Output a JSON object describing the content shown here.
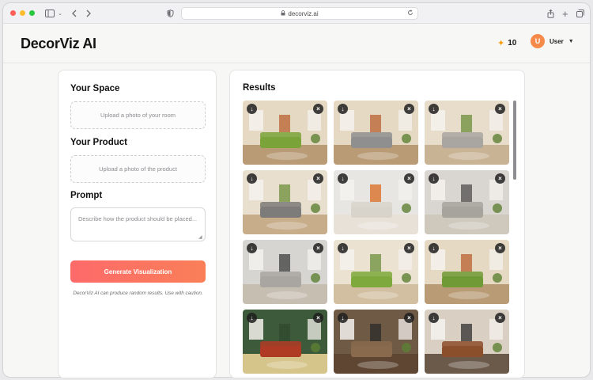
{
  "browser": {
    "url": "decorviz.ai"
  },
  "header": {
    "brand": "DecorViz AI",
    "credits": "10",
    "user": {
      "initial": "U",
      "name": "User"
    }
  },
  "form": {
    "space_title": "Your Space",
    "space_upload": "Upload a photo of your room",
    "product_title": "Your Product",
    "product_upload": "Upload a photo of the product",
    "prompt_title": "Prompt",
    "prompt_placeholder": "Describe how the product should be placed...",
    "prompt_value": "",
    "generate_label": "Generate Visualization",
    "disclaimer": "DecorViz AI can produce random results. Use with caution."
  },
  "results": {
    "title": "Results",
    "tiles": [
      {
        "name": "fireplace-room-green-sofa",
        "wall": "#e6d9c4",
        "floor": "#b99b76",
        "sofa": "#7aa33a",
        "accent": "#b8612f"
      },
      {
        "name": "fireplace-room-gray-sofa",
        "wall": "#e6d9c4",
        "floor": "#b99b76",
        "sofa": "#8f8f8f",
        "accent": "#b8612f"
      },
      {
        "name": "beige-room-gray-sectional",
        "wall": "#e8dccb",
        "floor": "#c9b395",
        "sofa": "#a9a6a2",
        "accent": "#6b8f3a"
      },
      {
        "name": "beige-room-tufted-sofa",
        "wall": "#e9dfcf",
        "floor": "#c7ad8a",
        "sofa": "#7e7c7a",
        "accent": "#6b8f3a"
      },
      {
        "name": "white-room-fireplace-art",
        "wall": "#e8e6e2",
        "floor": "#e7e1d8",
        "sofa": "#d8d3cb",
        "accent": "#d9681e"
      },
      {
        "name": "gray-room-sectional",
        "wall": "#d9d6d1",
        "floor": "#cfc8bd",
        "sofa": "#a7a39d",
        "accent": "#4e4e4e"
      },
      {
        "name": "gray-room-window-sofa",
        "wall": "#d7d5d1",
        "floor": "#c6beb1",
        "sofa": "#a9a5a0",
        "accent": "#3d3d3d"
      },
      {
        "name": "beige-room-green-sofa",
        "wall": "#ece2d2",
        "floor": "#d2bea0",
        "sofa": "#7ea93c",
        "accent": "#6b8f3a"
      },
      {
        "name": "fireplace-room-green-sofa-2",
        "wall": "#e6d9c4",
        "floor": "#b99b76",
        "sofa": "#6f9a36",
        "accent": "#b8612f"
      },
      {
        "name": "green-room-patterned-rug",
        "wall": "#3d5a3a",
        "floor": "#d6c58a",
        "sofa": "#b03b25",
        "accent": "#2f4a2d"
      },
      {
        "name": "dark-living-room",
        "wall": "#6f5a45",
        "floor": "#5e4632",
        "sofa": "#8a6a4c",
        "accent": "#2b2b2b"
      },
      {
        "name": "brown-leather-sofa-room",
        "wall": "#d9cfc2",
        "floor": "#6b5a4a",
        "sofa": "#8c4f2c",
        "accent": "#2f2f2f"
      }
    ]
  },
  "icons": {
    "download": "↓",
    "remove": "×",
    "sparkle": "✦",
    "caret": "▼",
    "lock": "🔒",
    "reload": "↻"
  }
}
